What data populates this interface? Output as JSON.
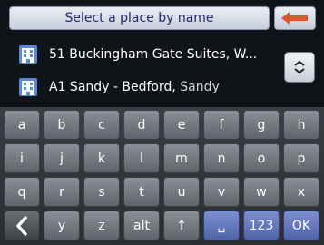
{
  "header": {
    "search_placeholder": "Select a place by name",
    "back_icon": "arrow-left-icon",
    "back_icon_color": "#d7582d"
  },
  "results": {
    "items": [
      {
        "name": "51 Buckingham Gate Suites, W...",
        "secondary": ""
      },
      {
        "name": "A1 Sandy - Bedford, ",
        "secondary": "Sandy"
      }
    ],
    "item_icon": "building-icon",
    "scroll_icon": "up-down-icon"
  },
  "keyboard": {
    "row1": [
      "a",
      "b",
      "c",
      "d",
      "e",
      "f",
      "g",
      "h"
    ],
    "row2": [
      "i",
      "j",
      "k",
      "l",
      "m",
      "n",
      "o",
      "p"
    ],
    "row3": [
      "q",
      "r",
      "s",
      "t",
      "u",
      "v",
      "w",
      "x"
    ],
    "row4": [
      "y",
      "z",
      "alt",
      "↑",
      "␣",
      "123",
      "OK"
    ],
    "back_key_icon": "chevron-left-icon",
    "key_color": "#6e7279",
    "blue_key_color": "#5a6db6"
  }
}
